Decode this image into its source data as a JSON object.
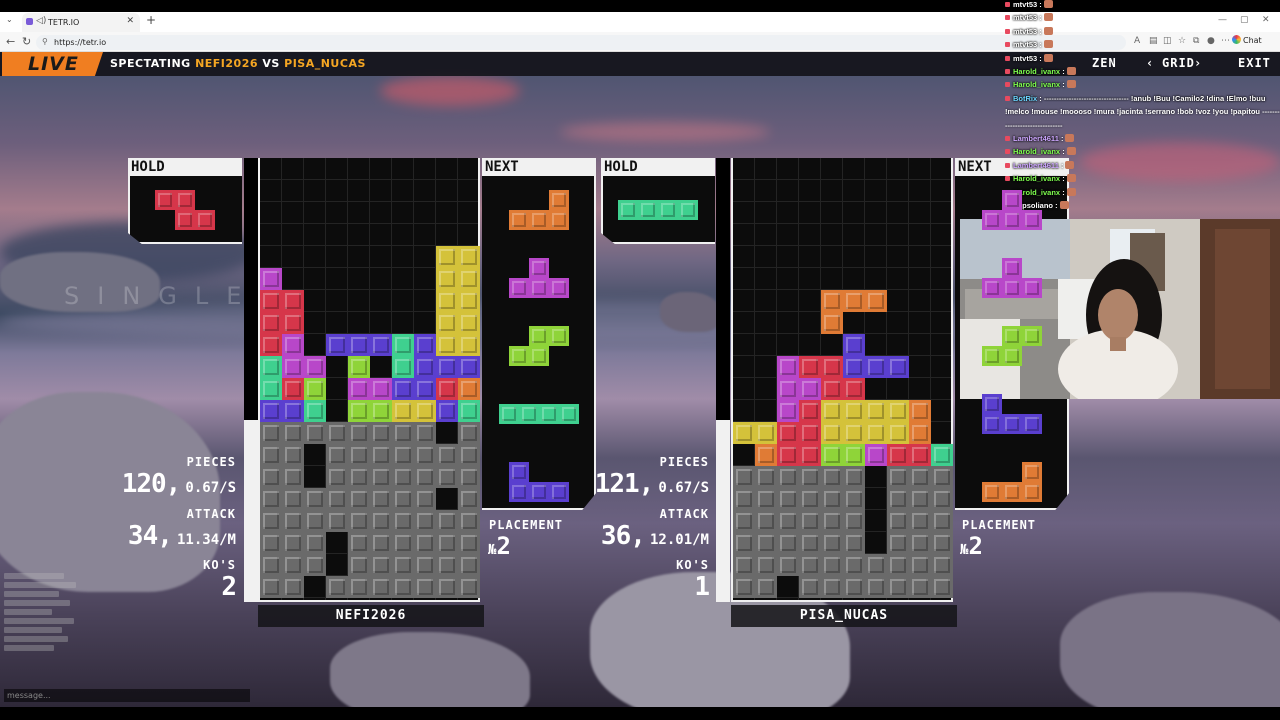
{
  "browser": {
    "tab_title": "TETR.IO",
    "url": "https://tetr.io",
    "chat_button_label": "Chat"
  },
  "hud": {
    "live_label": "LIVE",
    "spectating_label": "SPECTATING",
    "vs_label": "VS",
    "player1_name": "NEFI2026",
    "player2_name": "PISA_NUCAS",
    "zen_label": "ZEN",
    "grid_label": "GRID",
    "exit_label": "EXIT"
  },
  "labels": {
    "hold": "HOLD",
    "next": "NEXT",
    "pieces": "PIECES",
    "attack": "ATTACK",
    "kos": "KO'S",
    "placement": "PLACEMENT"
  },
  "clear_message": "SINGLE",
  "message_placeholder": "message...",
  "colors": {
    "Z": "#d6364a",
    "S": "#8fd439",
    "T": "#b847c9",
    "J": "#5a3fcf",
    "L": "#e07b35",
    "O": "#d4c23a",
    "I": "#3fd08f",
    "G": "#6a6a6a",
    "accent": "#f07e21"
  },
  "players": [
    {
      "name": "NEFI2026",
      "hold": "Z",
      "next": [
        "L",
        "T",
        "S",
        "I",
        "J"
      ],
      "pieces": "120,",
      "pps": "0.67/S",
      "attack": "34,",
      "apm": "11.34/M",
      "kos": "2",
      "placement_prefix": "№",
      "placement": "2",
      "grid": [
        "..........",
        "..........",
        "..........",
        "..........",
        "........OO",
        "T.......OO",
        "ZZ......OO",
        "ZZ......OO",
        "ZT.JJJIJOO",
        "ITT.S.IJJJ",
        "IZS.TTJJZL",
        "JJI.SSOOJI",
        "GGGGGGGG.G",
        "GG.GGGGGGG",
        "GG.GGGGGGG",
        "GGGGGGGG.G",
        "GGGGGGGGGG",
        "GGG.GGGGGG",
        "GGG.GGGGGG",
        "GG.GGGGGGG"
      ]
    },
    {
      "name": "PISA_NUCAS",
      "hold": "I",
      "next": [
        "T",
        "T",
        "S",
        "J",
        "L"
      ],
      "pieces": "121,",
      "pps": "0.67/S",
      "attack": "36,",
      "apm": "12.01/M",
      "kos": "1",
      "placement_prefix": "№",
      "placement": "2",
      "grid": [
        "..........",
        "..........",
        "..........",
        "..........",
        "..........",
        "..........",
        "....LLL...",
        "....L.....",
        ".....J....",
        "..TZZJJJ..",
        "..TTZZ....",
        "..TZOOOOL.",
        "OOZZOOOOL.",
        ".LZZSSTZZI",
        "GGGGGG.GGG",
        "GGGGGG.GGG",
        "GGGGGG.GGG",
        "GGGGGG.GGG",
        "GGGGGGGGGG",
        "GG.GGGGGGG"
      ]
    }
  ],
  "stream_chat": [
    {
      "user": "mtvt53",
      "text": ":"
    },
    {
      "user": "mtvt53",
      "text": ":"
    },
    {
      "user": "mtvt53",
      "text": ":"
    },
    {
      "user": "mtvt53",
      "text": ":"
    },
    {
      "user": "mtvt53",
      "text": ":"
    },
    {
      "user": "Harold_ivanx",
      "text": ":"
    },
    {
      "user": "Harold_ivanx",
      "text": ":"
    },
    {
      "user": "BotRix",
      "text": ": ---------------------------------- !anub !Buu !Camilo2 !dina !Elmo !buu"
    },
    {
      "user": "",
      "text": "!melco !mouse !moooso !mura !jacinta !serrano !bob !voz !you !papitou ----------"
    },
    {
      "user": "",
      "text": "-----------------------"
    },
    {
      "user": "Lambert4611",
      "text": ":"
    },
    {
      "user": "Harold_ivanx",
      "text": ":"
    },
    {
      "user": "Lambert4611",
      "text": ":"
    },
    {
      "user": "Harold_ivanx",
      "text": ":"
    },
    {
      "user": "Harold_ivanx",
      "text": ":"
    },
    {
      "user": "Lopsoliano",
      "text": ":"
    }
  ]
}
